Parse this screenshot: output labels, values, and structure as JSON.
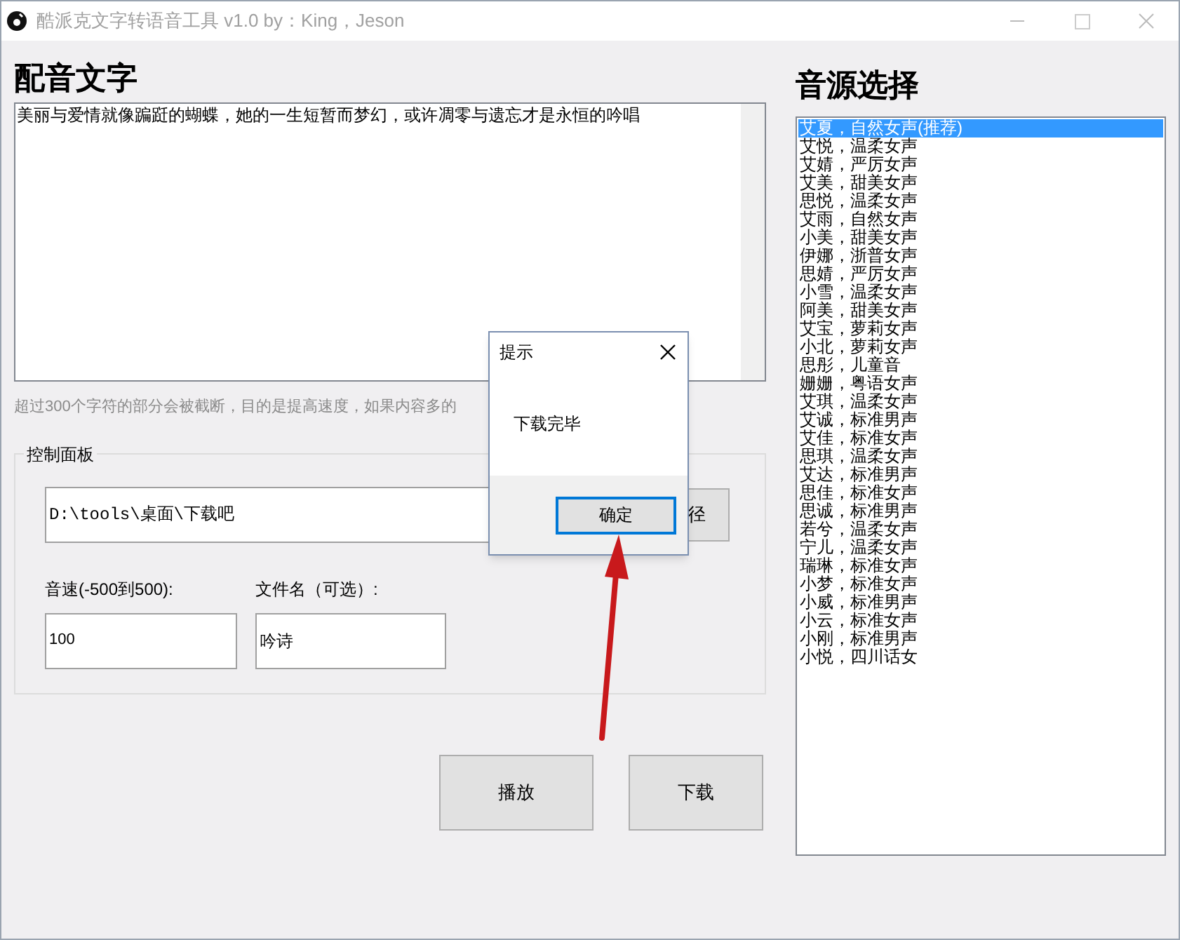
{
  "window": {
    "title": "酷派克文字转语音工具 v1.0 by：King，Jeson"
  },
  "text_section": {
    "heading": "配音文字",
    "value": "美丽与爱情就像蹁跹的蝴蝶，她的一生短暂而梦幻，或许凋零与遗忘才是永恒的吟唱",
    "hint": "超过300个字符的部分会被截断，目的是提高速度，如果内容多的"
  },
  "control_panel": {
    "title": "控制面板",
    "path": "D:\\tools\\桌面\\下载吧",
    "path_button": "径",
    "speed_label": "音速(-500到500):",
    "speed": "100",
    "filename_label": "文件名（可选）:",
    "filename": "吟诗"
  },
  "buttons": [
    "播放",
    "下载"
  ],
  "voice_section": {
    "heading": "音源选择",
    "items": [
      {
        "label": "艾夏，自然女声(推荐)",
        "selected": true
      },
      {
        "label": "艾悦，温柔女声",
        "selected": false
      },
      {
        "label": "艾婧，严厉女声",
        "selected": false
      },
      {
        "label": "艾美，甜美女声",
        "selected": false
      },
      {
        "label": "思悦，温柔女声",
        "selected": false
      },
      {
        "label": "艾雨，自然女声",
        "selected": false
      },
      {
        "label": "小美，甜美女声",
        "selected": false
      },
      {
        "label": "伊娜，浙普女声",
        "selected": false
      },
      {
        "label": "思婧，严厉女声",
        "selected": false
      },
      {
        "label": "小雪，温柔女声",
        "selected": false
      },
      {
        "label": "阿美，甜美女声",
        "selected": false
      },
      {
        "label": "艾宝，萝莉女声",
        "selected": false
      },
      {
        "label": "小北，萝莉女声",
        "selected": false
      },
      {
        "label": "思彤，儿童音",
        "selected": false
      },
      {
        "label": "姗姗，粤语女声",
        "selected": false
      },
      {
        "label": "艾琪，温柔女声",
        "selected": false
      },
      {
        "label": "艾诚，标准男声",
        "selected": false
      },
      {
        "label": "艾佳，标准女声",
        "selected": false
      },
      {
        "label": "思琪，温柔女声",
        "selected": false
      },
      {
        "label": "艾达，标准男声",
        "selected": false
      },
      {
        "label": "思佳，标准女声",
        "selected": false
      },
      {
        "label": "思诚，标准男声",
        "selected": false
      },
      {
        "label": "若兮，温柔女声",
        "selected": false
      },
      {
        "label": "宁儿，温柔女声",
        "selected": false
      },
      {
        "label": "瑞琳，标准女声",
        "selected": false
      },
      {
        "label": "小梦，标准女声",
        "selected": false
      },
      {
        "label": "小威，标准男声",
        "selected": false
      },
      {
        "label": "小云，标准女声",
        "selected": false
      },
      {
        "label": "小刚，标准男声",
        "selected": false
      },
      {
        "label": "小悦，四川话女",
        "selected": false
      }
    ]
  },
  "dialog": {
    "title": "提示",
    "message": "下载完毕",
    "ok": "确定"
  }
}
